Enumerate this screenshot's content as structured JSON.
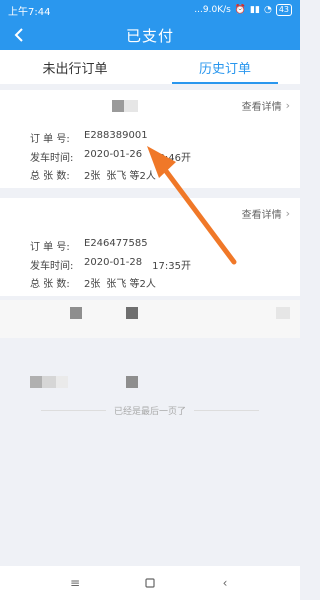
{
  "status_bar": {
    "time": "上午7:44",
    "network_speed": "...9.0K/s",
    "battery": "43"
  },
  "app_bar": {
    "title": "已支付"
  },
  "tabs": [
    {
      "label": "未出行订单",
      "active": false
    },
    {
      "label": "历史订单",
      "active": true
    }
  ],
  "orders": [
    {
      "detail_link": "查看详情",
      "order_no_label": "订 单 号:",
      "order_no": "E288389001",
      "depart_label": "发车时间:",
      "depart_date": "2020-01-26",
      "depart_time": "08:46开",
      "total_label": "总 张 数:",
      "total": "2张",
      "passengers": "张飞 等2人"
    },
    {
      "detail_link": "查看详情",
      "order_no_label": "订 单 号:",
      "order_no": "E246477585",
      "depart_label": "发车时间:",
      "depart_date": "2020-01-28",
      "depart_time": "17:35开",
      "total_label": "总 张 数:",
      "total": "2张",
      "passengers": "张飞 等2人"
    }
  ],
  "footer": {
    "end_text": "已经是最后一页了"
  },
  "colors": {
    "primary": "#2a97ee",
    "annotation_arrow": "#f07828"
  },
  "icons": {
    "back": "back-arrow-icon",
    "detail": "chevron-right-icon",
    "nav_menu": "menu-icon",
    "nav_home": "home-square-icon",
    "nav_back": "nav-back-icon"
  }
}
